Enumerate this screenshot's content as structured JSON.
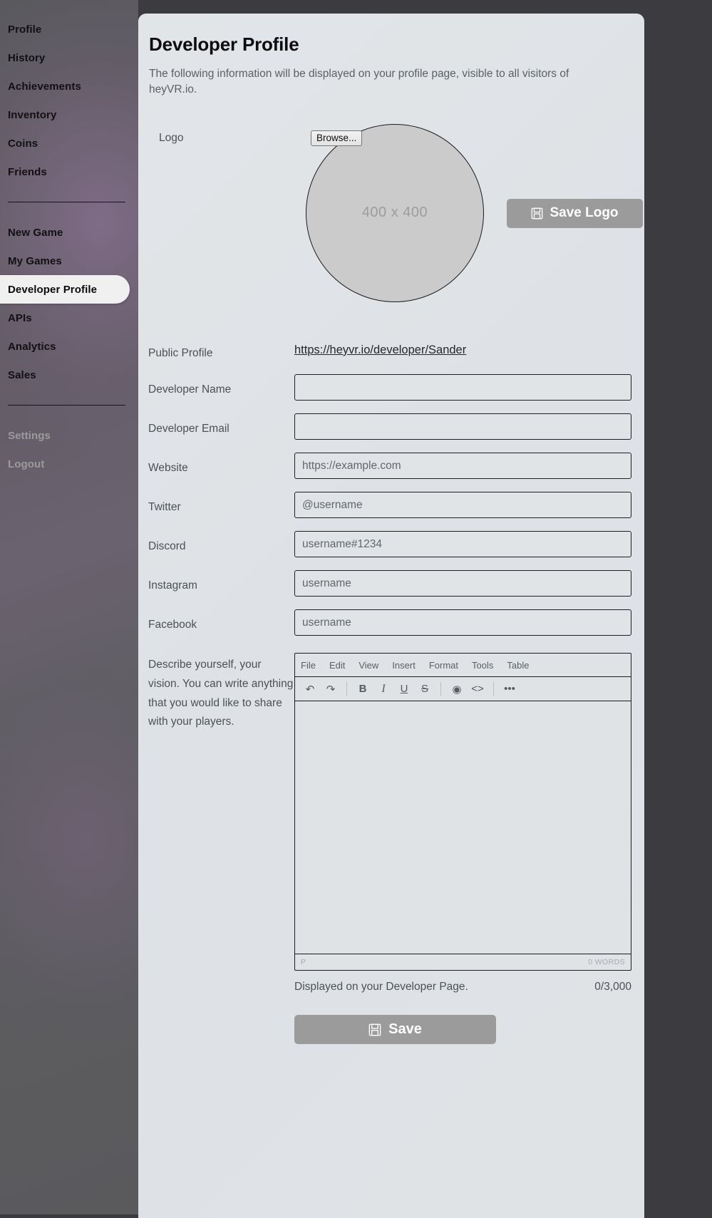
{
  "sidebar": {
    "groups": [
      {
        "items": [
          {
            "label": "Profile",
            "name": "profile",
            "state": "normal"
          },
          {
            "label": "History",
            "name": "history",
            "state": "normal"
          },
          {
            "label": "Achievements",
            "name": "achievements",
            "state": "normal"
          },
          {
            "label": "Inventory",
            "name": "inventory",
            "state": "normal"
          },
          {
            "label": "Coins",
            "name": "coins",
            "state": "normal"
          },
          {
            "label": "Friends",
            "name": "friends",
            "state": "normal"
          }
        ]
      },
      {
        "items": [
          {
            "label": "New Game",
            "name": "new-game",
            "state": "normal"
          },
          {
            "label": "My Games",
            "name": "my-games",
            "state": "normal"
          },
          {
            "label": "Developer Profile",
            "name": "developer-profile",
            "state": "active"
          },
          {
            "label": "APIs",
            "name": "apis",
            "state": "normal"
          },
          {
            "label": "Analytics",
            "name": "analytics",
            "state": "normal"
          },
          {
            "label": "Sales",
            "name": "sales",
            "state": "normal"
          }
        ]
      },
      {
        "items": [
          {
            "label": "Settings",
            "name": "settings",
            "state": "muted"
          },
          {
            "label": "Logout",
            "name": "logout",
            "state": "muted"
          }
        ]
      }
    ]
  },
  "page": {
    "title": "Developer Profile",
    "description": "The following information will be displayed on your profile page, visible to all visitors of heyVR.io."
  },
  "logo": {
    "label": "Logo",
    "browse_label": "Browse...",
    "placeholder_text": "400 x 400",
    "save_label": "Save Logo",
    "save_icon": "floppy-disk-icon"
  },
  "fields": {
    "public_profile": {
      "label": "Public Profile",
      "link_text": "https://heyvr.io/developer/Sander"
    },
    "developer_name": {
      "label": "Developer Name",
      "value": "",
      "placeholder": ""
    },
    "developer_email": {
      "label": "Developer Email",
      "value": "",
      "placeholder": ""
    },
    "website": {
      "label": "Website",
      "value": "",
      "placeholder": "https://example.com"
    },
    "twitter": {
      "label": "Twitter",
      "value": "",
      "placeholder": "@username"
    },
    "discord": {
      "label": "Discord",
      "value": "",
      "placeholder": "username#1234"
    },
    "instagram": {
      "label": "Instagram",
      "value": "",
      "placeholder": "username"
    },
    "facebook": {
      "label": "Facebook",
      "value": "",
      "placeholder": "username"
    }
  },
  "editor": {
    "label": "Describe yourself, your vision. You can write anything that you would like to share with your players.",
    "menubar": [
      {
        "label": "File",
        "name": "file"
      },
      {
        "label": "Edit",
        "name": "edit"
      },
      {
        "label": "View",
        "name": "view"
      },
      {
        "label": "Insert",
        "name": "insert"
      },
      {
        "label": "Format",
        "name": "format"
      },
      {
        "label": "Tools",
        "name": "tools"
      },
      {
        "label": "Table",
        "name": "table"
      }
    ],
    "toolbar": [
      {
        "name": "undo-icon",
        "glyph": "↶"
      },
      {
        "name": "redo-icon",
        "glyph": "↷"
      },
      {
        "name": "bold-icon",
        "glyph": "B"
      },
      {
        "name": "italic-icon",
        "glyph": "I"
      },
      {
        "name": "underline-icon",
        "glyph": "U"
      },
      {
        "name": "strikethrough-icon",
        "glyph": "S"
      },
      {
        "name": "preview-eye-icon",
        "glyph": "◉"
      },
      {
        "name": "source-code-icon",
        "glyph": "<>"
      },
      {
        "name": "more-options-icon",
        "glyph": "•••"
      }
    ],
    "content": "",
    "status_path": "P",
    "status_words": "0 WORDS",
    "help_text": "Displayed on your Developer Page.",
    "char_counter": "0/3,000"
  },
  "footer": {
    "save_label": "Save",
    "save_icon": "floppy-disk-icon"
  },
  "colors": {
    "panel_bg": "#dfe3e6",
    "button_gray": "#9b9b9b",
    "active_nav_bg": "#f0f0f0",
    "label_text": "#4c5156"
  }
}
